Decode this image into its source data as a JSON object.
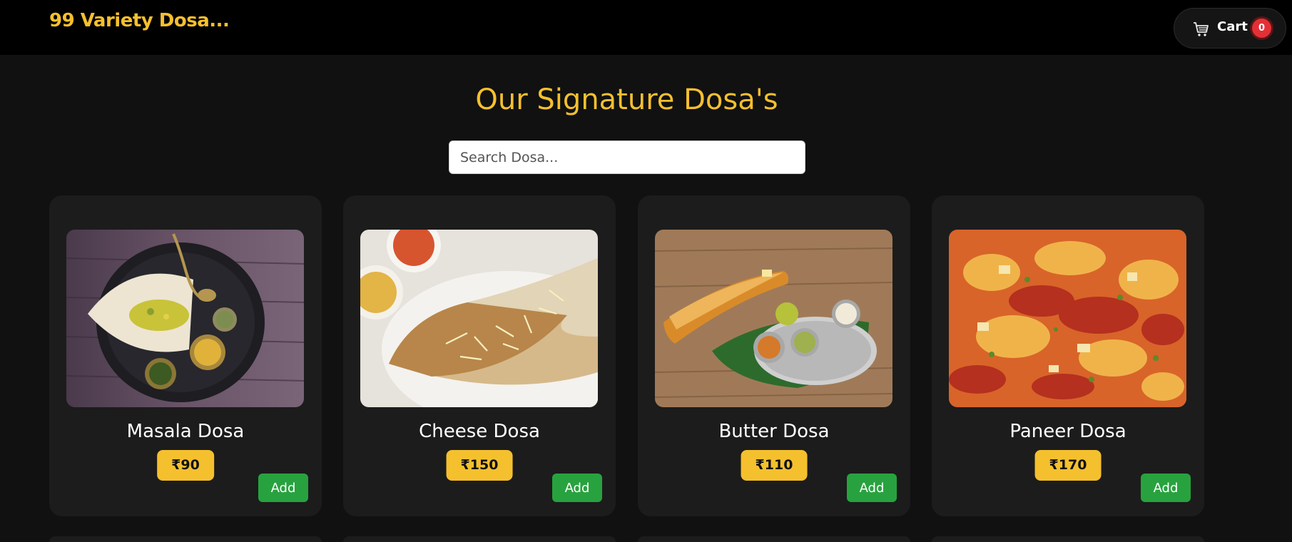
{
  "header": {
    "brand": "99 Variety Dosa...",
    "cart_label": "Cart",
    "cart_count": "0",
    "cart_icon": "shopping-cart-icon"
  },
  "main": {
    "title": "Our Signature Dosa's",
    "search": {
      "placeholder": "Search Dosa...",
      "value": ""
    }
  },
  "products": [
    {
      "name": "Masala Dosa",
      "price": "₹90",
      "add_label": "Add"
    },
    {
      "name": "Cheese Dosa",
      "price": "₹150",
      "add_label": "Add"
    },
    {
      "name": "Butter Dosa",
      "price": "₹110",
      "add_label": "Add"
    },
    {
      "name": "Paneer Dosa",
      "price": "₹170",
      "add_label": "Add"
    }
  ],
  "colors": {
    "accent": "#f5c02e",
    "add_button": "#28a23f",
    "badge": "#e33036",
    "card_bg": "#1c1c1c",
    "page_bg": "#111111",
    "header_bg": "#000000"
  }
}
